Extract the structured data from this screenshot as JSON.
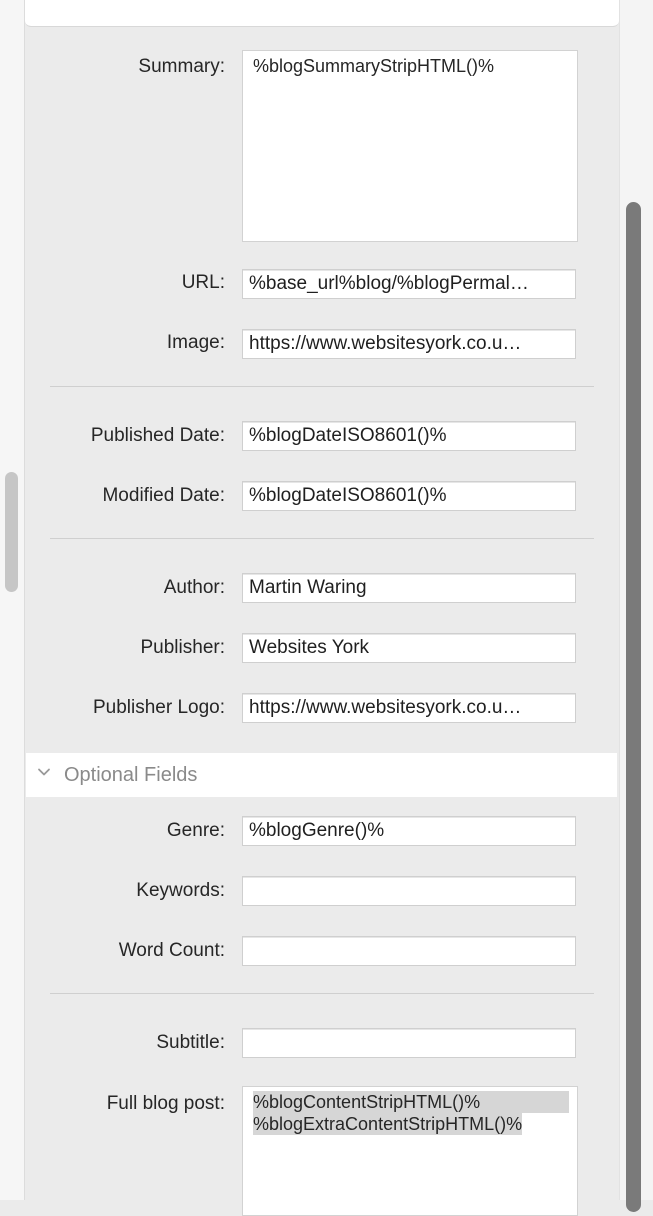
{
  "summary": {
    "label": "Summary:",
    "value": "%blogSummaryStripHTML()%"
  },
  "url": {
    "label": "URL:",
    "value": "%base_url%blog/%blogPermal…"
  },
  "image": {
    "label": "Image:",
    "value": "https://www.websitesyork.co.u…"
  },
  "published_date": {
    "label": "Published Date:",
    "value": "%blogDateISO8601()%"
  },
  "modified_date": {
    "label": "Modified Date:",
    "value": "%blogDateISO8601()%"
  },
  "author": {
    "label": "Author:",
    "value": "Martin Waring"
  },
  "publisher": {
    "label": "Publisher:",
    "value": "Websites York"
  },
  "publisher_logo": {
    "label": "Publisher Logo:",
    "value": "https://www.websitesyork.co.u…"
  },
  "optional_fields": {
    "title": "Optional Fields",
    "icon": "chevron-down-icon",
    "genre": {
      "label": "Genre:",
      "value": "%blogGenre()%"
    },
    "keywords": {
      "label": "Keywords:",
      "value": ""
    },
    "word_count": {
      "label": "Word Count:",
      "value": ""
    },
    "subtitle": {
      "label": "Subtitle:",
      "value": ""
    },
    "full_blog_post": {
      "label": "Full blog post:",
      "line1": "%blogContentStripHTML()%",
      "line2": "%blogExtraContentStripHTML()%"
    }
  }
}
